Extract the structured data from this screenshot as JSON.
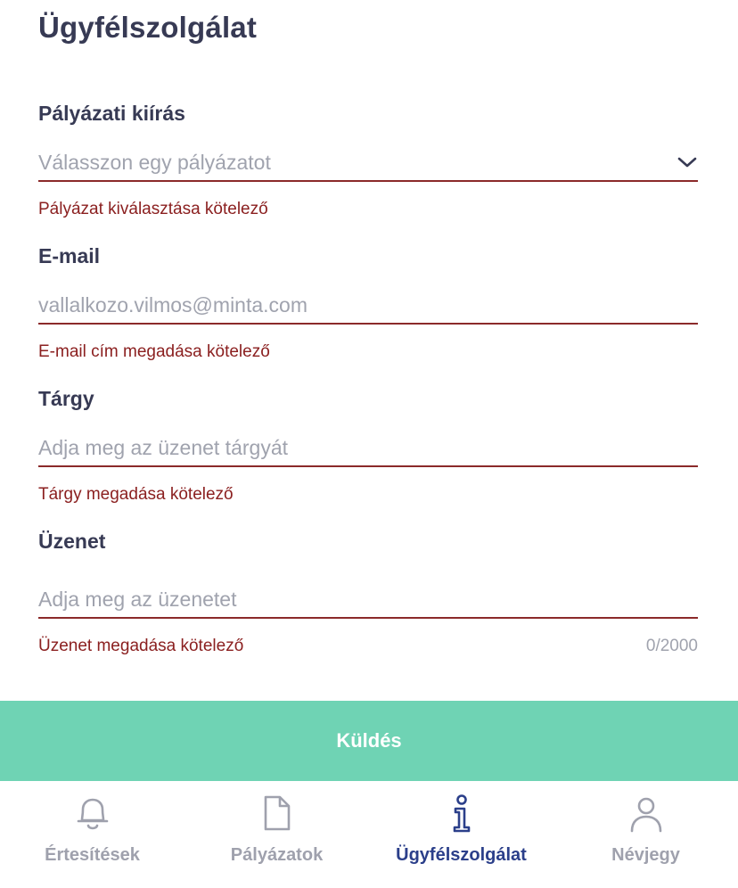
{
  "page": {
    "title": "Ügyfélszolgálat"
  },
  "form": {
    "tender": {
      "label": "Pályázati kiírás",
      "placeholder": "Válasszon egy pályázatot",
      "error": "Pályázat kiválasztása kötelező"
    },
    "email": {
      "label": "E-mail",
      "placeholder": "vallalkozo.vilmos@minta.com",
      "value": "",
      "error": "E-mail cím megadása kötelező"
    },
    "subject": {
      "label": "Tárgy",
      "placeholder": "Adja meg az üzenet tárgyát",
      "value": "",
      "error": "Tárgy megadása kötelező"
    },
    "message": {
      "label": "Üzenet",
      "placeholder": "Adja meg az üzenetet",
      "value": "",
      "error": "Üzenet megadása kötelező",
      "counter": "0/2000"
    },
    "submit_label": "Küldés"
  },
  "tabbar": {
    "items": [
      {
        "label": "Értesítések",
        "icon": "bell-icon",
        "active": false
      },
      {
        "label": "Pályázatok",
        "icon": "document-icon",
        "active": false
      },
      {
        "label": "Ügyfélszolgálat",
        "icon": "info-icon",
        "active": true
      },
      {
        "label": "Névjegy",
        "icon": "person-icon",
        "active": false
      }
    ]
  },
  "colors": {
    "text": "#373a54",
    "error": "#8b2020",
    "placeholder": "#a0a3ae",
    "button": "#6fd3b4",
    "tab_active": "#2b3f8a",
    "tab_inactive": "#9fa1ad"
  }
}
